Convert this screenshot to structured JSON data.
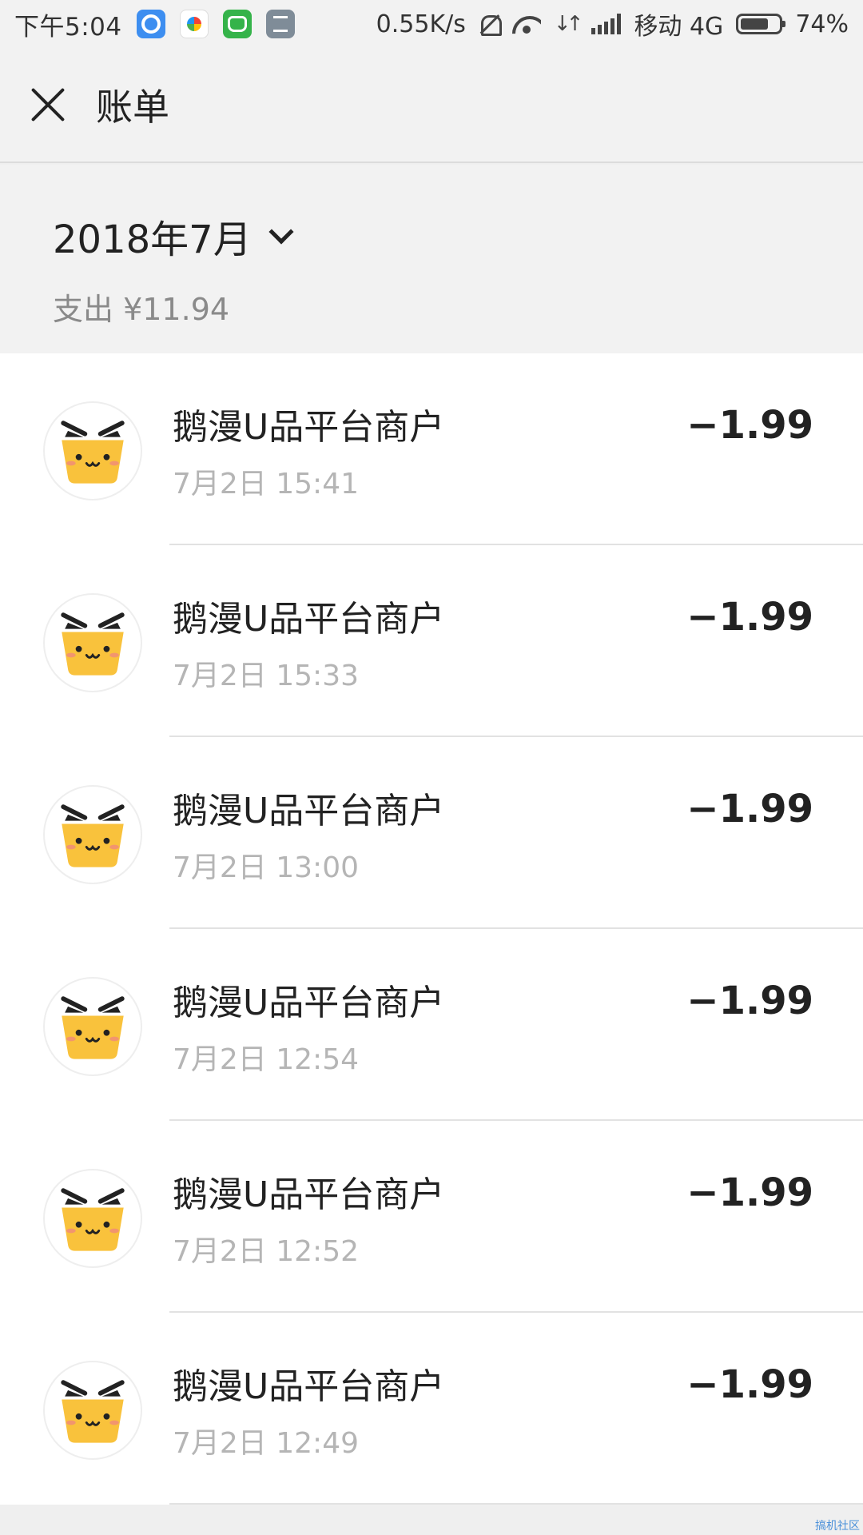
{
  "status_bar": {
    "time": "下午5:04",
    "net_speed": "0.55K/s",
    "carrier": "移动 4G",
    "battery": "74%",
    "battery_level": 0.74,
    "app_icons": [
      "messenger-app-icon",
      "photos-app-icon",
      "android-app-icon",
      "notes-app-icon"
    ]
  },
  "header": {
    "title": "账单",
    "close_icon": "close-icon"
  },
  "summary": {
    "month": "2018年7月",
    "spent": "支出 ¥11.94",
    "dropdown_icon": "chevron-down-icon"
  },
  "transactions": [
    {
      "merchant": "鹅漫U品平台商户",
      "time": "7月2日 15:41",
      "amount": "−1.99"
    },
    {
      "merchant": "鹅漫U品平台商户",
      "time": "7月2日 15:33",
      "amount": "−1.99"
    },
    {
      "merchant": "鹅漫U品平台商户",
      "time": "7月2日 13:00",
      "amount": "−1.99"
    },
    {
      "merchant": "鹅漫U品平台商户",
      "time": "7月2日 12:54",
      "amount": "−1.99"
    },
    {
      "merchant": "鹅漫U品平台商户",
      "time": "7月2日 12:52",
      "amount": "−1.99"
    },
    {
      "merchant": "鹅漫U品平台商户",
      "time": "7月2日 12:49",
      "amount": "−1.99"
    }
  ],
  "watermark": "搞机社区",
  "colors": {
    "background": "#f2f2f2",
    "list_background": "#ffffff",
    "avatar_yellow": "#f9c23c",
    "secondary_text": "#b5b5b5"
  }
}
